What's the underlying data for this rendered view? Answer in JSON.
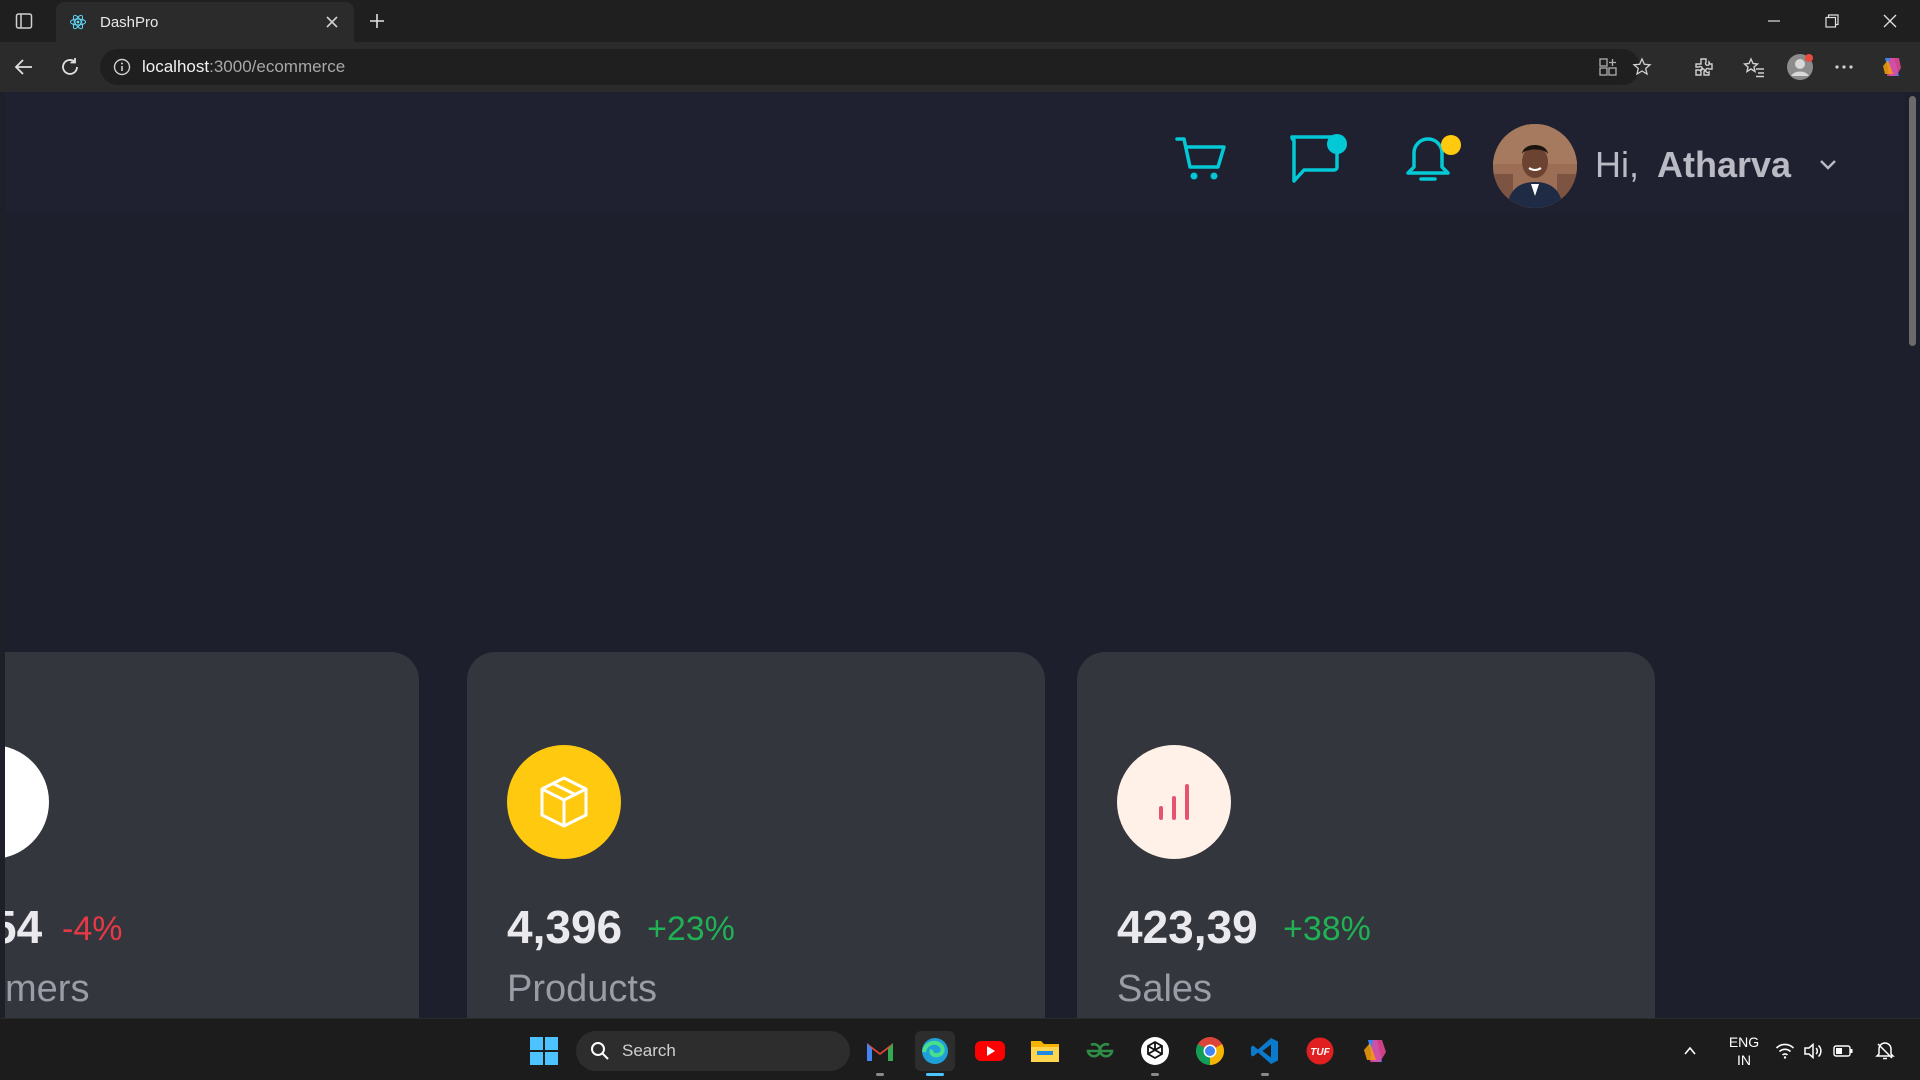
{
  "browser": {
    "tab_title": "DashPro",
    "url_host": "localhost",
    "url_path": ":3000/ecommerce"
  },
  "header": {
    "greeting": "Hi,",
    "user_name": "Atharva",
    "chat_dot_color": "#03c9d7",
    "notification_dot_color": "#fec90f",
    "icon_color": "#03c9d7"
  },
  "cards": [
    {
      "value": "54",
      "change": "-4%",
      "change_color": "#e63946",
      "label": "mers"
    },
    {
      "value": "4,396",
      "change": "+23%",
      "change_color": "#1fb154",
      "label": "Products",
      "icon": "box-icon",
      "icon_bg": "#fec90f"
    },
    {
      "value": "423,39",
      "change": "+38%",
      "change_color": "#1fb154",
      "label": "Sales",
      "icon": "bar-chart-icon",
      "icon_bg": "#fff1e8"
    }
  ],
  "taskbar": {
    "search_placeholder": "Search",
    "lang_line1": "ENG",
    "lang_line2": "IN"
  }
}
